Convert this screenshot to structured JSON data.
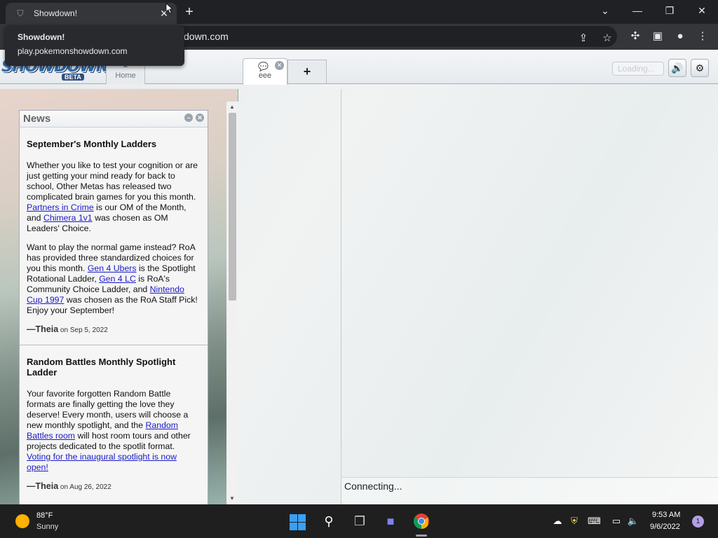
{
  "browser": {
    "tab_title": "Showdown!",
    "tab_close": "✕",
    "new_tab": "+",
    "url_visible": "down.com",
    "tooltip": {
      "title": "Showdown!",
      "url": "play.pokemonshowdown.com"
    },
    "window_controls": [
      "⌄",
      "—",
      "❐",
      "✕"
    ]
  },
  "header": {
    "logo": {
      "text": "SHOWDOWN",
      "badge": "BETA"
    },
    "tabs": [
      {
        "label": "Home"
      },
      {
        "label": "eee"
      },
      {
        "label": "+"
      }
    ],
    "loading_label": "Loading...",
    "sound_icon": "🔊",
    "settings_icon": "⚙"
  },
  "news": {
    "title": "News",
    "items": [
      {
        "heading": "September's Monthly Ladders",
        "p1_a": "Whether you like to test your cognition or are just getting your mind ready for back to school, Other Metas has released two complicated brain games for you this month. ",
        "p1_link1": "Partners in Crime",
        "p1_b": " is our OM of the Month, and ",
        "p1_link2": "Chimera 1v1",
        "p1_c": " was chosen as OM Leaders' Choice.",
        "p2_a": "Want to play the normal game instead? RoA has provided three standardized choices for you this month. ",
        "p2_link1": "Gen 4 Ubers",
        "p2_b": " is the Spotlight Rotational Ladder, ",
        "p2_link2": "Gen 4 LC",
        "p2_c": " is RoA's Community Choice Ladder, and ",
        "p2_link3": "Nintendo Cup 1997",
        "p2_d": " was chosen as the RoA Staff Pick! Enjoy your September!",
        "author": "—Theia",
        "date": " on Sep 5, 2022"
      },
      {
        "heading": "Random Battles Monthly Spotlight Ladder",
        "p1_a": "Your favorite forgotten Random Battle formats are finally getting the love they deserve! Every month, users will choose a new monthly spotlight, and the ",
        "p1_link1": "Random Battles room",
        "p1_b": " will host room tours and other projects dedicated to the spotlit format. ",
        "p1_link2": "Voting for the inaugural spotlight is now open!",
        "author": "—Theia",
        "date": " on Aug 26, 2022"
      }
    ]
  },
  "room": {
    "status": "Connecting..."
  },
  "taskbar": {
    "weather_temp": "88°F",
    "weather_desc": "Sunny",
    "time": "9:53 AM",
    "date": "9/6/2022",
    "notification_count": "1"
  }
}
